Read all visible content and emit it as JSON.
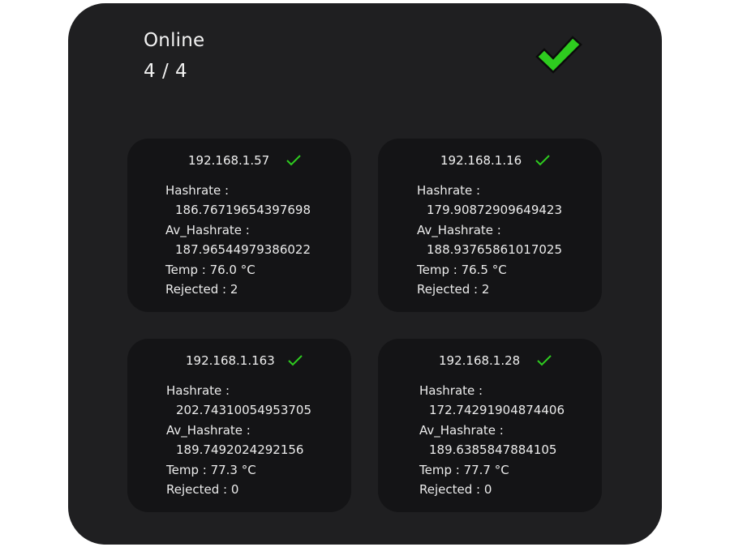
{
  "status": {
    "title": "Online",
    "count": "4 / 4",
    "ok_icon": "checkmark-icon",
    "ok_color": "#2ecc1f"
  },
  "miners": [
    {
      "ip": "192.168.1.57",
      "hashrate_label": "Hashrate :",
      "hashrate": "186.76719654397698",
      "av_hashrate_label": "Av_Hashrate :",
      "av_hashrate": "187.96544979386022",
      "temp": "Temp : 76.0 °C",
      "rejected": "Rejected : 2",
      "status_icon": "checkmark-icon"
    },
    {
      "ip": "192.168.1.16",
      "hashrate_label": "Hashrate :",
      "hashrate": "179.90872909649423",
      "av_hashrate_label": "Av_Hashrate :",
      "av_hashrate": "188.93765861017025",
      "temp": "Temp : 76.5 °C",
      "rejected": "Rejected : 2",
      "status_icon": "checkmark-icon"
    },
    {
      "ip": "192.168.1.163",
      "hashrate_label": "Hashrate :",
      "hashrate": "202.74310054953705",
      "av_hashrate_label": "Av_Hashrate :",
      "av_hashrate": "189.7492024292156",
      "temp": "Temp : 77.3 °C",
      "rejected": "Rejected : 0",
      "status_icon": "checkmark-icon"
    },
    {
      "ip": "192.168.1.28",
      "hashrate_label": "Hashrate :",
      "hashrate": "172.74291904874406",
      "av_hashrate_label": "Av_Hashrate :",
      "av_hashrate": "189.6385847884105",
      "temp": "Temp : 77.7 °C",
      "rejected": "Rejected : 0",
      "status_icon": "checkmark-icon"
    }
  ]
}
